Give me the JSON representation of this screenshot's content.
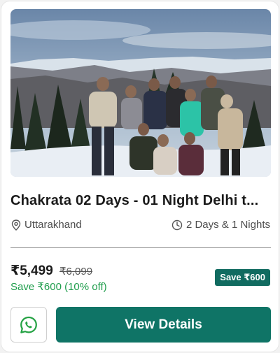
{
  "card": {
    "image": {
      "alt": "Group of travelers posing in snow with mountains behind"
    },
    "title": "Chakrata 02 Days - 01 Night Delhi t...",
    "location": {
      "icon": "location-pin-icon",
      "text": "Uttarakhand"
    },
    "duration": {
      "icon": "clock-icon",
      "text": "2 Days & 1 Nights"
    },
    "price": {
      "current": "₹5,499",
      "original": "₹6,099",
      "savings_text": "Save ₹600 (10% off)",
      "badge": "Save ₹600"
    },
    "actions": {
      "whatsapp_icon": "whatsapp-icon",
      "view_details_label": "View Details"
    }
  },
  "colors": {
    "brand_teal": "#0f7466",
    "savings_green": "#1f9d4c",
    "whatsapp_green": "#25a244"
  }
}
